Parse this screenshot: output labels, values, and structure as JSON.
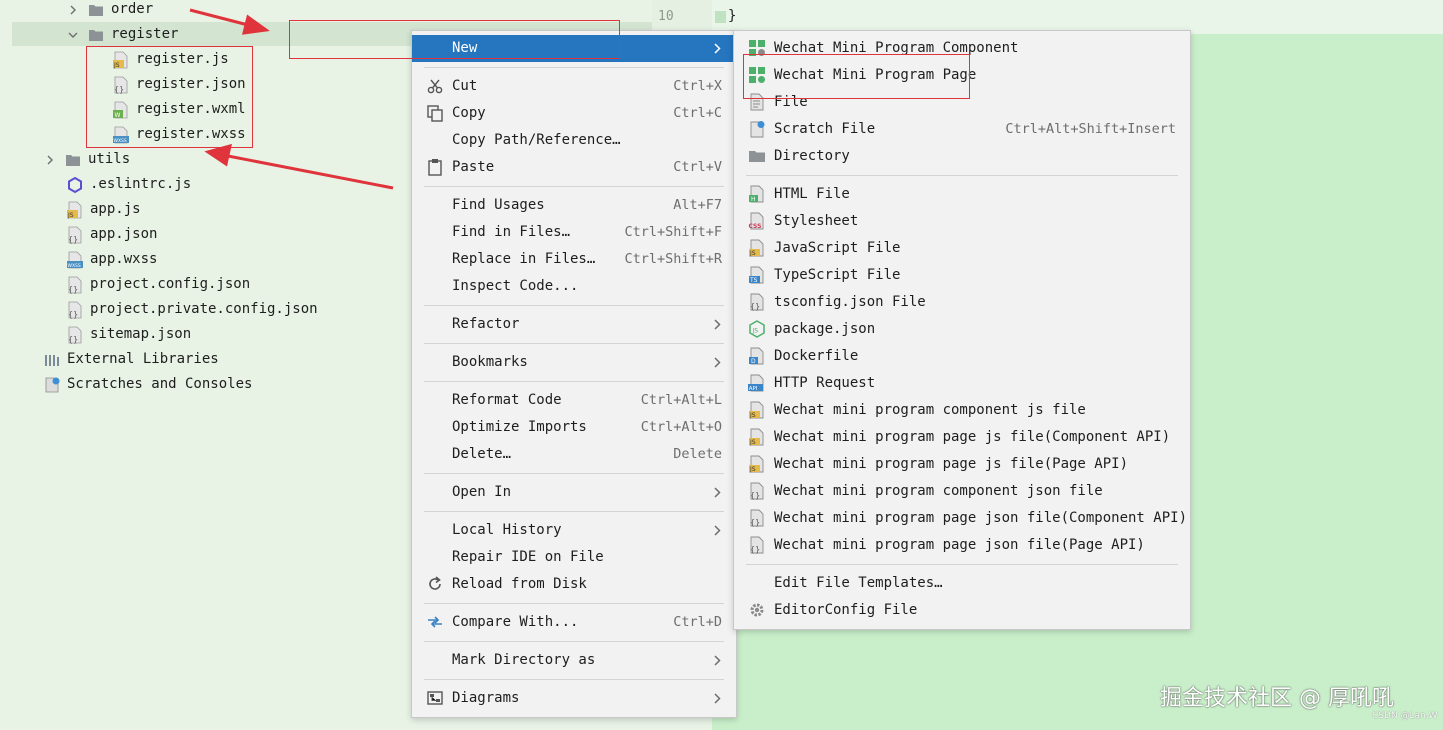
{
  "colors": {
    "tree_bg": "#e8f3e6",
    "menu_bg": "#f2f2f2",
    "menu_active": "#2675bf",
    "annotation_red": "#e0343c",
    "editor_bg": "#c9efca"
  },
  "editor": {
    "line_number": "10",
    "code": "}"
  },
  "tree": {
    "folders": [
      {
        "label": "order",
        "state": "collapsed",
        "icon": "folder-icon"
      },
      {
        "label": "register",
        "state": "expanded",
        "icon": "folder-icon"
      },
      {
        "label": "utils",
        "state": "collapsed",
        "icon": "folder-icon"
      }
    ],
    "register_files": [
      {
        "label": "register.js",
        "icon": "js-file-icon",
        "badge": "JS"
      },
      {
        "label": "register.json",
        "icon": "json-file-icon",
        "badge": "{}"
      },
      {
        "label": "register.wxml",
        "icon": "wxml-file-icon",
        "badge": "W"
      },
      {
        "label": "register.wxss",
        "icon": "wxss-file-icon",
        "badge": "WXSS"
      }
    ],
    "root_files": [
      {
        "label": ".eslintrc.js",
        "icon": "eslint-icon"
      },
      {
        "label": "app.js",
        "icon": "js-file-icon"
      },
      {
        "label": "app.json",
        "icon": "json-file-icon"
      },
      {
        "label": "app.wxss",
        "icon": "wxss-file-icon"
      },
      {
        "label": "project.config.json",
        "icon": "json-file-icon"
      },
      {
        "label": "project.private.config.json",
        "icon": "json-file-icon"
      },
      {
        "label": "sitemap.json",
        "icon": "json-file-icon"
      }
    ],
    "external_libraries": "External Libraries",
    "scratches": "Scratches and Consoles"
  },
  "context_menu": {
    "items": [
      {
        "label": "New",
        "submenu": true,
        "active": true
      },
      {
        "label": "Cut",
        "shortcut": "Ctrl+X",
        "icon": "scissors-icon"
      },
      {
        "label": "Copy",
        "shortcut": "Ctrl+C",
        "icon": "copy-icon"
      },
      {
        "label": "Copy Path/Reference…"
      },
      {
        "label": "Paste",
        "shortcut": "Ctrl+V",
        "icon": "clipboard-icon"
      },
      {
        "label": "Find Usages",
        "shortcut": "Alt+F7"
      },
      {
        "label": "Find in Files…",
        "shortcut": "Ctrl+Shift+F"
      },
      {
        "label": "Replace in Files…",
        "shortcut": "Ctrl+Shift+R"
      },
      {
        "label": "Inspect Code..."
      },
      {
        "label": "Refactor",
        "submenu": true
      },
      {
        "label": "Bookmarks",
        "submenu": true
      },
      {
        "label": "Reformat Code",
        "shortcut": "Ctrl+Alt+L"
      },
      {
        "label": "Optimize Imports",
        "shortcut": "Ctrl+Alt+O"
      },
      {
        "label": "Delete…",
        "shortcut": "Delete"
      },
      {
        "label": "Open In",
        "submenu": true
      },
      {
        "label": "Local History",
        "submenu": true
      },
      {
        "label": "Repair IDE on File"
      },
      {
        "label": "Reload from Disk",
        "icon": "reload-icon"
      },
      {
        "label": "Compare With...",
        "shortcut": "Ctrl+D",
        "icon": "compare-icon"
      },
      {
        "label": "Mark Directory as",
        "submenu": true
      },
      {
        "label": "Diagrams",
        "submenu": true,
        "icon": "diagram-icon"
      }
    ]
  },
  "new_submenu": {
    "items": [
      {
        "label": "Wechat Mini Program Component",
        "icon": "wechat-component-icon"
      },
      {
        "label": "Wechat Mini Program Page",
        "icon": "wechat-page-icon"
      },
      {
        "label": "File",
        "icon": "file-icon"
      },
      {
        "label": "Scratch File",
        "shortcut": "Ctrl+Alt+Shift+Insert",
        "icon": "scratch-file-icon"
      },
      {
        "label": "Directory",
        "icon": "folder-icon"
      },
      {
        "label": "HTML File",
        "icon": "html-file-icon",
        "badge": "H"
      },
      {
        "label": "Stylesheet",
        "icon": "css-file-icon",
        "badge": "CSS"
      },
      {
        "label": "JavaScript File",
        "icon": "js-file-icon",
        "badge": "JS"
      },
      {
        "label": "TypeScript File",
        "icon": "ts-file-icon",
        "badge": "TS"
      },
      {
        "label": "tsconfig.json File",
        "icon": "json-file-icon",
        "badge": "{}"
      },
      {
        "label": "package.json",
        "icon": "nodejs-icon",
        "badge": "JS"
      },
      {
        "label": "Dockerfile",
        "icon": "docker-icon",
        "badge": "D"
      },
      {
        "label": "HTTP Request",
        "icon": "api-icon",
        "badge": "API"
      },
      {
        "label": "Wechat mini program component js file",
        "icon": "js-file-icon",
        "badge": "JS"
      },
      {
        "label": "Wechat mini program page js file(Component API)",
        "icon": "js-file-icon",
        "badge": "JS"
      },
      {
        "label": "Wechat mini program page js file(Page API)",
        "icon": "js-file-icon",
        "badge": "JS"
      },
      {
        "label": "Wechat mini program component json file",
        "icon": "json-file-icon",
        "badge": "{}"
      },
      {
        "label": "Wechat mini program page json file(Component API)",
        "icon": "json-file-icon",
        "badge": "{}"
      },
      {
        "label": "Wechat mini program page json file(Page API)",
        "icon": "json-file-icon",
        "badge": "{}"
      },
      {
        "label": "Edit File Templates…"
      },
      {
        "label": "EditorConfig File",
        "icon": "gear-icon"
      }
    ]
  },
  "watermark": {
    "main": "掘金技术社区 @ 厚吼吼",
    "small": "CSDN @Lan.W"
  }
}
